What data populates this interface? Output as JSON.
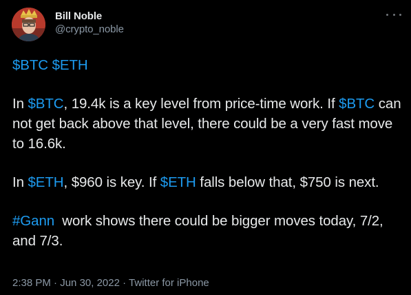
{
  "author": {
    "display_name": "Bill Noble",
    "handle": "@crypto_noble"
  },
  "tweet": {
    "tickers": [
      "$BTC",
      "$ETH"
    ],
    "p2": {
      "a": "In ",
      "btc1": "$BTC",
      "b": ", 19.4k is a key level from price-time work. If ",
      "btc2": "$BTC",
      "c": " can not get back above that level, there could be a very fast move to 16.6k."
    },
    "p3": {
      "a": "In ",
      "eth1": "$ETH",
      "b": ", $960 is key. If ",
      "eth2": "$ETH",
      "c": " falls below that, $750 is next."
    },
    "p4": {
      "hashtag": "#Gann",
      "c": "  work shows there could be bigger moves today, 7/2, and 7/3."
    }
  },
  "meta": {
    "time": "2:38 PM",
    "separator": " · ",
    "date": "Jun 30, 2022",
    "source": "Twitter for iPhone"
  },
  "colors": {
    "background": "#000000",
    "text": "#e7e9ea",
    "link": "#1d9bf0",
    "secondary": "#8b98a5"
  },
  "icons": {
    "more": "more-horizontal-icon",
    "avatar": "user-avatar-image"
  }
}
